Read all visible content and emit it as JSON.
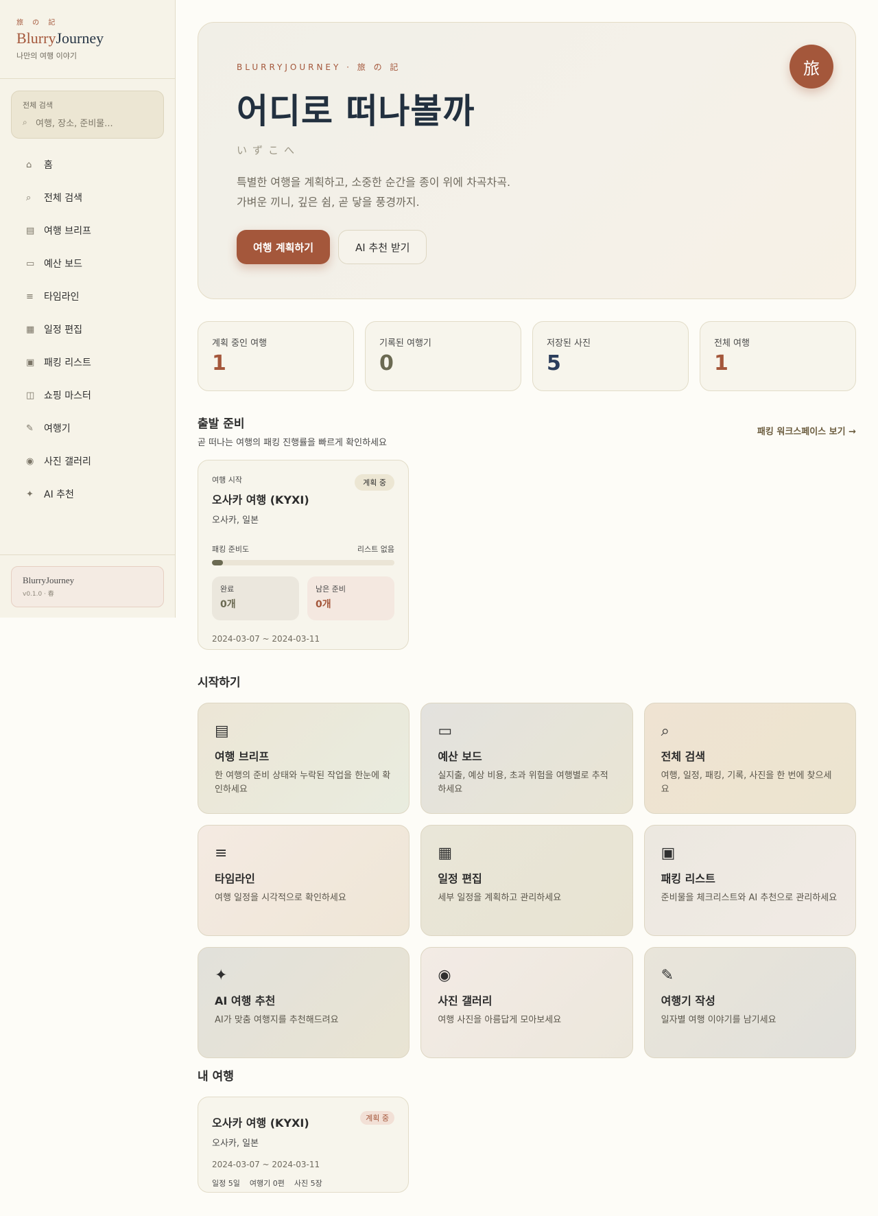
{
  "sidebar": {
    "brand_kanji": "旅 の 記",
    "brand_blurry": "Blurry",
    "brand_journey": "Journey",
    "brand_sub": "나만의 여행 이야기",
    "search_label": "전체 검색",
    "search_placeholder": "여행, 장소, 준비물...",
    "items": [
      {
        "label": "홈",
        "icon": "home-icon"
      },
      {
        "label": "전체 검색",
        "icon": "search-icon"
      },
      {
        "label": "여행 브리프",
        "icon": "brief-icon"
      },
      {
        "label": "예산 보드",
        "icon": "wallet-icon"
      },
      {
        "label": "타임라인",
        "icon": "timeline-icon"
      },
      {
        "label": "일정 편집",
        "icon": "calendar-icon"
      },
      {
        "label": "패킹 리스트",
        "icon": "suitcase-icon"
      },
      {
        "label": "쇼핑 마스터",
        "icon": "shopping-icon"
      },
      {
        "label": "여행기",
        "icon": "journal-icon"
      },
      {
        "label": "사진 갤러리",
        "icon": "camera-icon"
      },
      {
        "label": "AI 추천",
        "icon": "sparkle-icon"
      }
    ],
    "version_name": "BlurryJourney",
    "version_sub": "v0.1.0 · 春"
  },
  "hero": {
    "eyebrow": "BLURRYJOURNEY · 旅 の 記",
    "title": "어디로 떠나볼까",
    "kana": "いずこへ",
    "desc_line1": "특별한 여행을 계획하고, 소중한 순간을 종이 위에 차곡차곡.",
    "desc_line2": "가벼운 끼니, 깊은 쉼, 곧 닿을 풍경까지.",
    "primary_button": "여행 계획하기",
    "secondary_button": "AI 추천 받기",
    "badge": "旅"
  },
  "stats": [
    {
      "label": "계획 중인 여행",
      "value": "1",
      "color": "#a4573b"
    },
    {
      "label": "기록된 여행기",
      "value": "0",
      "color": "#6b6a52"
    },
    {
      "label": "저장된 사진",
      "value": "5",
      "color": "#2c3e5c"
    },
    {
      "label": "전체 여행",
      "value": "1",
      "color": "#a4573b"
    }
  ],
  "departure": {
    "title": "출발 준비",
    "subtitle": "곧 떠나는 여행의 패킹 진행률을 빠르게 확인하세요",
    "link": "패킹 워크스페이스 보기 →",
    "card": {
      "eyebrow": "여행 시작",
      "badge": "계획 중",
      "name": "오사카 여행 (KYXI)",
      "location": "오사카, 일본",
      "progress_label": "패킹 준비도",
      "progress_status": "리스트 없음",
      "progress_percent": 0,
      "done_label": "완료",
      "done_value": "0개",
      "left_label": "남은 준비",
      "left_value": "0개",
      "dates": "2024-03-07 ~ 2024-03-11"
    }
  },
  "start": {
    "title": "시작하기",
    "features": [
      {
        "title": "여행 브리프",
        "desc": "한 여행의 준비 상태와 누락된 작업을 한눈에 확인하세요",
        "icon": "brief-icon"
      },
      {
        "title": "예산 보드",
        "desc": "실지출, 예상 비용, 초과 위험을 여행별로 추적하세요",
        "icon": "wallet-icon"
      },
      {
        "title": "전체 검색",
        "desc": "여행, 일정, 패킹, 기록, 사진을 한 번에 찾으세요",
        "icon": "search-icon"
      },
      {
        "title": "타임라인",
        "desc": "여행 일정을 시각적으로 확인하세요",
        "icon": "timeline-icon"
      },
      {
        "title": "일정 편집",
        "desc": "세부 일정을 계획하고 관리하세요",
        "icon": "calendar-icon"
      },
      {
        "title": "패킹 리스트",
        "desc": "준비물을 체크리스트와 AI 추천으로 관리하세요",
        "icon": "suitcase-icon"
      },
      {
        "title": "AI 여행 추천",
        "desc": "AI가 맞춤 여행지를 추천해드려요",
        "icon": "sparkle-icon"
      },
      {
        "title": "사진 갤러리",
        "desc": "여행 사진을 아름답게 모아보세요",
        "icon": "camera-icon"
      },
      {
        "title": "여행기 작성",
        "desc": "일자별 여행 이야기를 남기세요",
        "icon": "journal-icon"
      }
    ]
  },
  "my_trips": {
    "title": "내 여행",
    "card": {
      "name": "오사카 여행 (KYXI)",
      "badge": "계획 중",
      "location": "오사카, 일본",
      "dates": "2024-03-07 ~ 2024-03-11",
      "schedule": "일정 5일",
      "journal": "여행기 0편",
      "photos": "사진 5장"
    }
  }
}
